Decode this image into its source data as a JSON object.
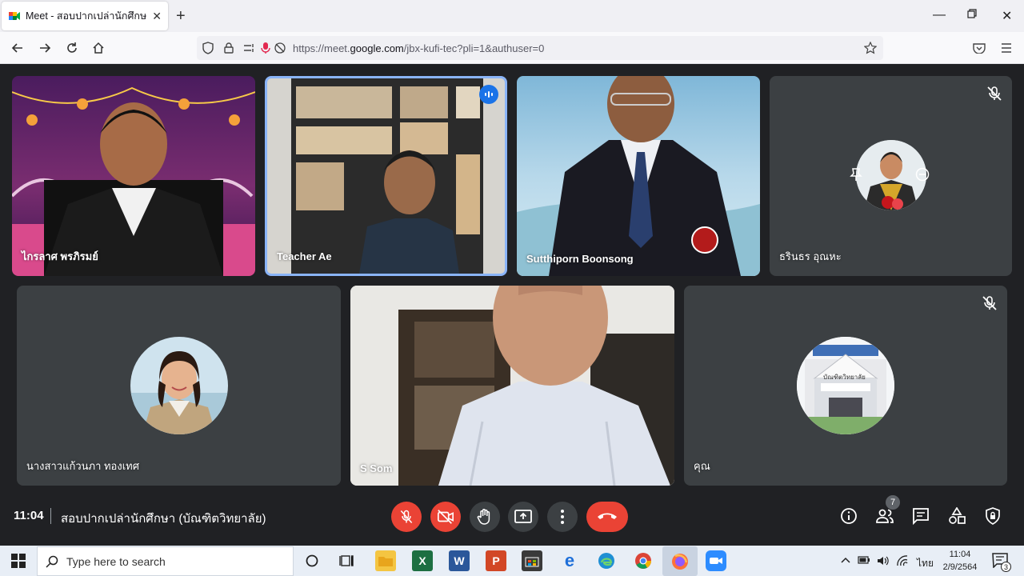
{
  "browser": {
    "tab_title": "Meet - สอบปากเปล่านักศึกษา (บัณ",
    "url_prefix": "https://meet.",
    "url_domain": "google.com",
    "url_suffix": "/jbx-kufi-tec?pli=1&authuser=0"
  },
  "participants": [
    {
      "name": "ไกรลาศ พรภิรมย์"
    },
    {
      "name": "Teacher Ae"
    },
    {
      "name": "Sutthiporn Boonsong"
    },
    {
      "name": "ธรินธร อุณหะ"
    },
    {
      "name": "นางสาวแก้วนภา ทองเทศ"
    },
    {
      "name": "S Som"
    },
    {
      "name": "คุณ"
    }
  ],
  "avatar_caption": "บัณฑิตวิทยาลัย",
  "meeting": {
    "time": "11:04",
    "name": "สอบปากเปล่านักศึกษา (บัณฑิตวิทยาลัย)",
    "people_count": "7"
  },
  "taskbar": {
    "search_placeholder": "Type here to search",
    "ime": "ไทย",
    "time": "11:04",
    "date": "2/9/2564",
    "notification_count": "3"
  },
  "colors": {
    "meet_bg": "#202124",
    "tile_bg": "#3c4043",
    "danger": "#ea4335",
    "accent": "#1a73e8"
  }
}
